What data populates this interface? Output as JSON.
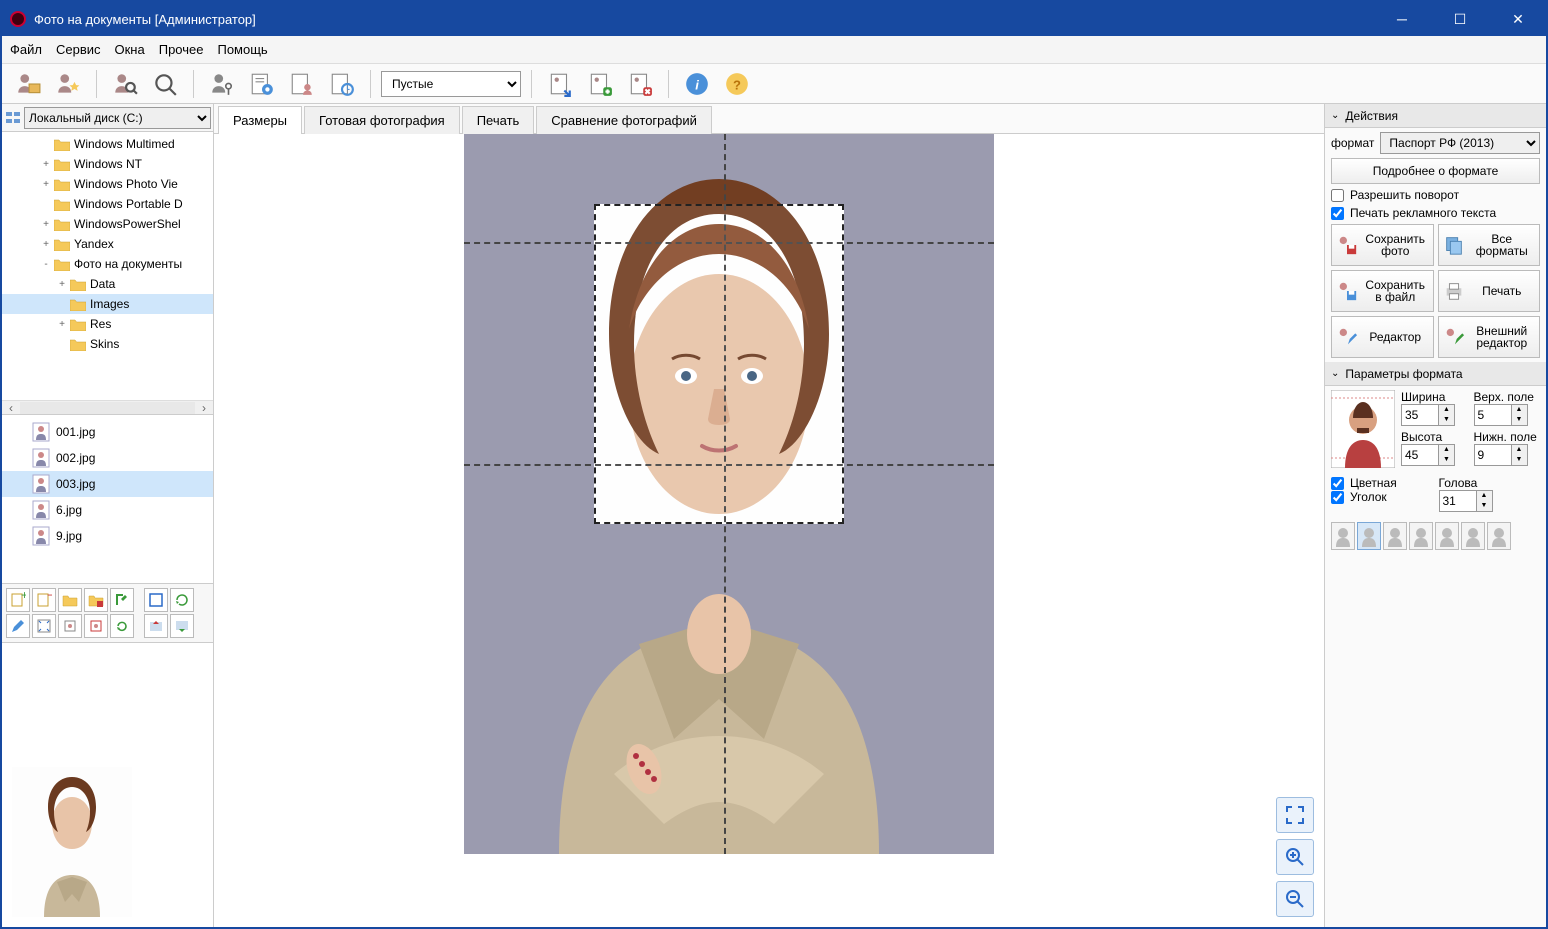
{
  "window": {
    "title": "Фото на документы  [Администратор]"
  },
  "menu": {
    "file": "Файл",
    "service": "Сервис",
    "windows": "Окна",
    "other": "Прочее",
    "help": "Помощь"
  },
  "toolbar": {
    "dropdown_value": "Пустые"
  },
  "drive": {
    "label": "Локальный диск (C:)"
  },
  "tree": [
    {
      "depth": 2,
      "exp": "",
      "label": "Windows Multimed"
    },
    {
      "depth": 2,
      "exp": "+",
      "label": "Windows NT"
    },
    {
      "depth": 2,
      "exp": "+",
      "label": "Windows Photo Vie"
    },
    {
      "depth": 2,
      "exp": "",
      "label": "Windows Portable D"
    },
    {
      "depth": 2,
      "exp": "+",
      "label": "WindowsPowerShel"
    },
    {
      "depth": 2,
      "exp": "+",
      "label": "Yandex"
    },
    {
      "depth": 2,
      "exp": "-",
      "label": "Фото на документы"
    },
    {
      "depth": 3,
      "exp": "+",
      "label": "Data"
    },
    {
      "depth": 3,
      "exp": "",
      "label": "Images",
      "sel": true
    },
    {
      "depth": 3,
      "exp": "+",
      "label": "Res"
    },
    {
      "depth": 3,
      "exp": "",
      "label": "Skins"
    }
  ],
  "files": [
    {
      "name": "001.jpg"
    },
    {
      "name": "002.jpg"
    },
    {
      "name": "003.jpg",
      "sel": true
    },
    {
      "name": "6.jpg"
    },
    {
      "name": "9.jpg"
    }
  ],
  "tabs": {
    "sizes": "Размеры",
    "ready": "Готовая фотография",
    "print": "Печать",
    "compare": "Сравнение фотографий"
  },
  "actions": {
    "title": "Действия",
    "format_label": "формат",
    "format_value": "Паспорт РФ (2013)",
    "more": "Подробнее о формате",
    "allow_rotate": "Разрешить поворот",
    "print_ad": "Печать рекламного текста",
    "save_photo": "Сохранить фото",
    "all_formats": "Все форматы",
    "save_file": "Сохранить в файл",
    "print_btn": "Печать",
    "editor": "Редактор",
    "ext_editor": "Внешний редактор"
  },
  "params": {
    "title": "Параметры формата",
    "width_label": "Ширина",
    "width": "35",
    "top_label": "Верх. поле",
    "top": "5",
    "height_label": "Высота",
    "height": "45",
    "bottom_label": "Нижн. поле",
    "bottom": "9",
    "color_label": "Цветная",
    "corner_label": "Уголок",
    "head_label": "Голова",
    "head": "31"
  }
}
